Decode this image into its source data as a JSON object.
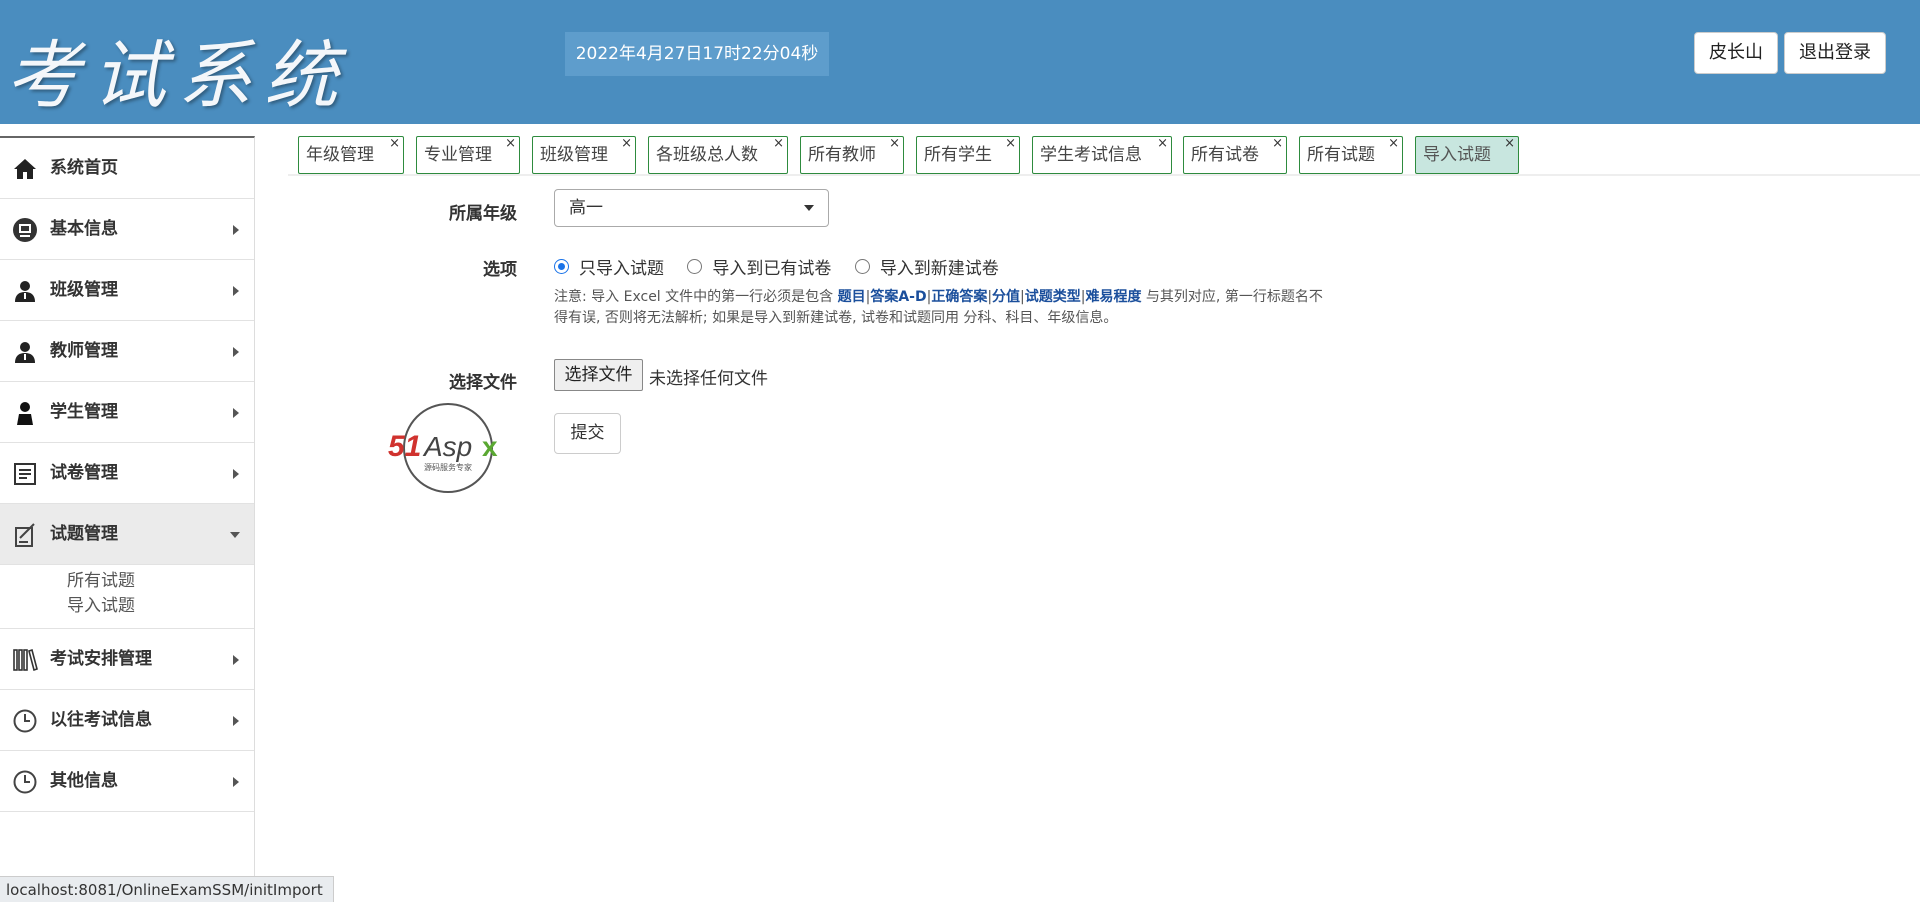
{
  "header": {
    "logo_text": "考试系统",
    "datetime": "2022年4月27日17时22分04秒",
    "user_name": "皮长山",
    "logout_label": "退出登录"
  },
  "sidebar": {
    "items": [
      {
        "label": "系统首页",
        "icon": "home-icon",
        "caret": "none"
      },
      {
        "label": "基本信息",
        "icon": "monitor-icon",
        "caret": "right"
      },
      {
        "label": "班级管理",
        "icon": "user-icon",
        "caret": "right"
      },
      {
        "label": "教师管理",
        "icon": "user-icon",
        "caret": "right"
      },
      {
        "label": "学生管理",
        "icon": "student-icon",
        "caret": "right"
      },
      {
        "label": "试卷管理",
        "icon": "document-icon",
        "caret": "right"
      },
      {
        "label": "试题管理",
        "icon": "quiz-icon",
        "caret": "down"
      },
      {
        "label": "考试安排管理",
        "icon": "books-icon",
        "caret": "right"
      },
      {
        "label": "以往考试信息",
        "icon": "clock-icon",
        "caret": "right"
      },
      {
        "label": "其他信息",
        "icon": "clock-icon",
        "caret": "right"
      }
    ],
    "submenu": [
      "所有试题",
      "导入试题"
    ]
  },
  "tabs": [
    {
      "label": "年级管理",
      "close": "×"
    },
    {
      "label": "专业管理",
      "close": "×"
    },
    {
      "label": "班级管理",
      "close": "×"
    },
    {
      "label": "各班级总人数",
      "close": "×"
    },
    {
      "label": "所有教师",
      "close": "×"
    },
    {
      "label": "所有学生",
      "close": "×"
    },
    {
      "label": "学生考试信息",
      "close": "×"
    },
    {
      "label": "所有试卷",
      "close": "×"
    },
    {
      "label": "所有试题",
      "close": "×"
    },
    {
      "label": "导入试题",
      "close": "×"
    }
  ],
  "form": {
    "grade_label": "所属年级",
    "grade_value": "高一",
    "options_label": "选项",
    "radio_options": [
      "只导入试题",
      "导入到已有试卷",
      "导入到新建试卷"
    ],
    "note_prefix": "注意: 导入 Excel 文件中的第一行必须是包含 ",
    "note_fields": [
      "题目",
      "答案A-D",
      "正确答案",
      "分值",
      "试题类型",
      "难易程度"
    ],
    "note_separator": "|",
    "note_suffix": " 与其列对应, 第一行标题名不得有误, 否则将无法解析; 如果是导入到新建试卷, 试卷和试题同用 分科、科目、年级信息。",
    "file_label": "选择文件",
    "file_button": "选择文件",
    "file_status": "未选择任何文件",
    "submit_label": "提交"
  },
  "watermark": {
    "brand": "51Aspx",
    "tagline": "源码服务专家"
  },
  "statusbar": {
    "url": "localhost:8081/OnlineExamSSM/initImport"
  }
}
